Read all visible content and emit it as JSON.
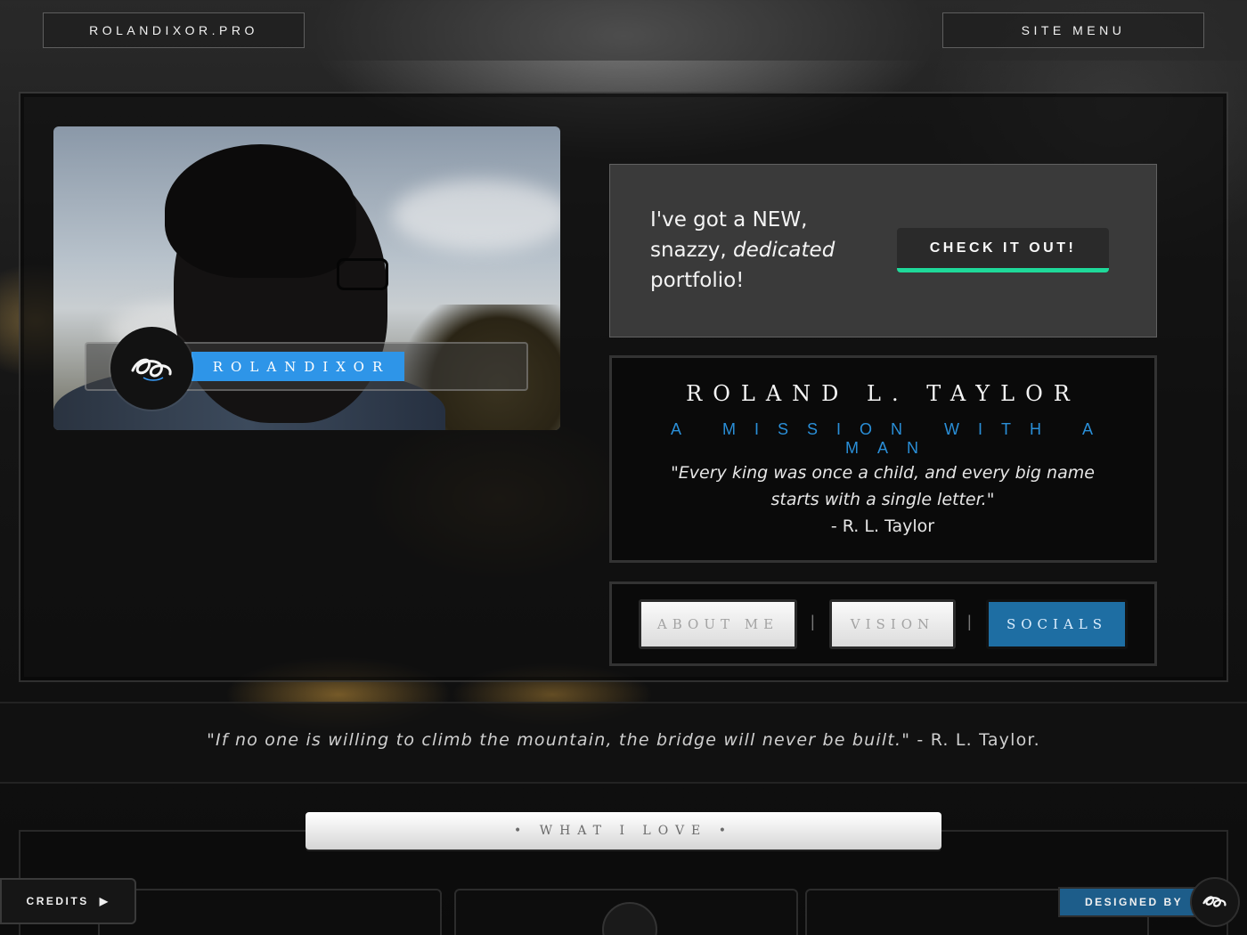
{
  "header": {
    "site_label": "ROLANDIXOR.PRO",
    "menu_label": "SITE MENU"
  },
  "hero": {
    "tag_label": "ROLANDIXOR",
    "promo": {
      "line1": "I've got a NEW,",
      "line2a": "snazzy, ",
      "line2b": "dedicated",
      "line3": "portfolio!",
      "cta_label": "CHECK IT OUT!",
      "cta_color": "#1fd99a"
    },
    "name": "ROLAND L. TAYLOR",
    "tagline": "A MISSION WITH A MAN",
    "quote_line1": "\"Every king was once a child, and every big name",
    "quote_line2": "starts with a single letter.\"",
    "quote_author": "- R. L. Taylor",
    "nav": {
      "about": "ABOUT ME",
      "vision": "VISION",
      "socials": "SOCIALS",
      "separator": "|"
    }
  },
  "strip": {
    "quote": "\"If no one is willing to climb the mountain, the bridge will never be built.\"",
    "author": " - R. L. Taylor."
  },
  "love_section": {
    "title": "• WHAT I LOVE •"
  },
  "footer": {
    "credits_label": "CREDITS",
    "credits_icon": "play-icon",
    "designed_label": "DESIGNED BY"
  },
  "colors": {
    "accent_blue": "#2e95e8",
    "socials_blue": "#1e6ea3"
  }
}
